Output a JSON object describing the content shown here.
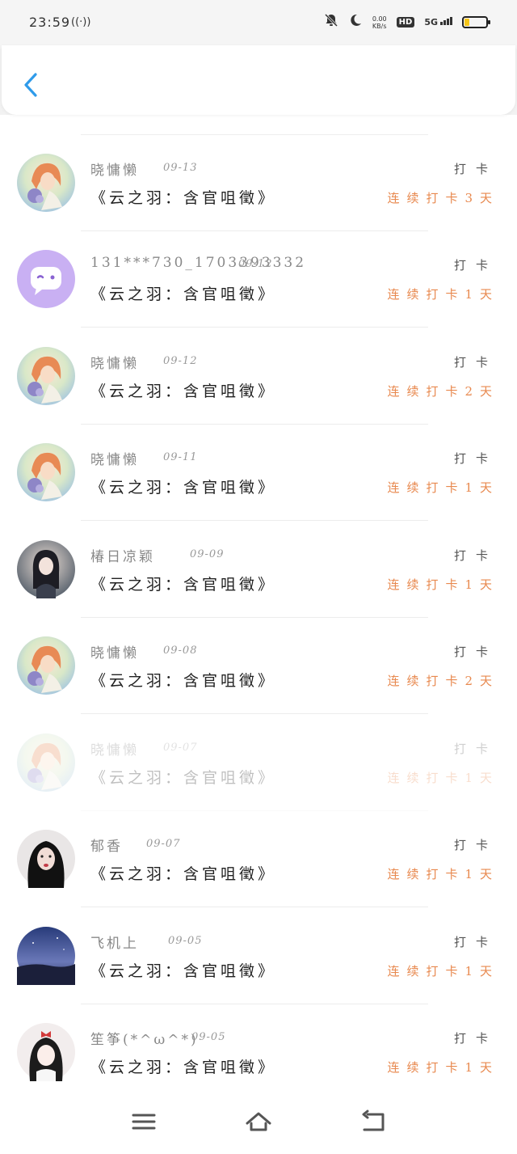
{
  "status_bar": {
    "time": "23:59",
    "signal_glyph": "((·))",
    "speed_value": "0.00",
    "speed_unit": "KB/s",
    "hd": "HD",
    "network": "5G"
  },
  "header": {
    "back_icon": "chevron-left-icon",
    "accent": "#2f9bea"
  },
  "list": {
    "check_label": "打卡",
    "items": [
      {
        "name": "晓慵懒",
        "date": "09-13",
        "title": "《云之羽：含官咀徵》",
        "streak": "连续打卡3天",
        "avatar": "anime-girl"
      },
      {
        "name": "131***730_1703393332",
        "date": "09-12",
        "title": "《云之羽：含官咀徵》",
        "streak": "连续打卡1天",
        "avatar": "chat-bubble"
      },
      {
        "name": "晓慵懒",
        "date": "09-12",
        "title": "《云之羽：含官咀徵》",
        "streak": "连续打卡2天",
        "avatar": "anime-girl"
      },
      {
        "name": "晓慵懒",
        "date": "09-11",
        "title": "《云之羽：含官咀徵》",
        "streak": "连续打卡1天",
        "avatar": "anime-girl"
      },
      {
        "name": "椿日凉颖",
        "date": "09-09",
        "title": "《云之羽：含官咀徵》",
        "streak": "连续打卡1天",
        "avatar": "dark-hair-girl"
      },
      {
        "name": "晓慵懒",
        "date": "09-08",
        "title": "《云之羽：含官咀徵》",
        "streak": "连续打卡2天",
        "avatar": "anime-girl"
      },
      {
        "name": "晓慵懒",
        "date": "09-07",
        "title": "《云之羽：含官咀徵》",
        "streak": "连续打卡1天",
        "avatar": "anime-girl"
      },
      {
        "name": "郁香",
        "date": "09-07",
        "title": "《云之羽：含官咀徵》",
        "streak": "连续打卡1天",
        "avatar": "dark-girl"
      },
      {
        "name": "飞机上",
        "date": "09-05",
        "title": "《云之羽：含官咀徵》",
        "streak": "连续打卡1天",
        "avatar": "sky"
      },
      {
        "name": "笙筝(*^ω^*)",
        "date": "09-05",
        "title": "《云之羽：含官咀徵》",
        "streak": "连续打卡1天",
        "avatar": "bow-girl"
      }
    ]
  },
  "nav": {
    "menu_icon": "menu-icon",
    "home_icon": "home-icon",
    "back_icon": "back-arrow-icon"
  },
  "colors": {
    "streak": "#e8894f",
    "name": "#888888",
    "title": "#222222",
    "back_accent": "#2f9bea"
  }
}
